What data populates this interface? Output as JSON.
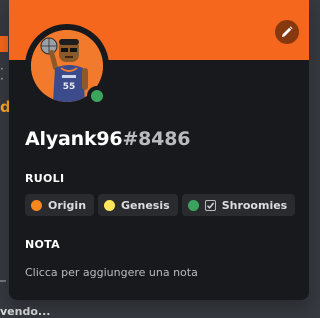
{
  "background": {
    "letter": "d",
    "typing_text": "vendo..."
  },
  "profile": {
    "banner_color": "#f5671c",
    "edit_icon": "pencil-icon",
    "status": "online",
    "status_color": "#3ba55d",
    "username": "Alyank96",
    "discriminator": "#8486",
    "jersey_number": "55"
  },
  "roles_section": {
    "title": "RUOLI",
    "roles": [
      {
        "name": "Origin",
        "color": "#f5871f",
        "checked": false
      },
      {
        "name": "Genesis",
        "color": "#fee75c",
        "checked": false
      },
      {
        "name": "Shroomies",
        "color": "#3ba55d",
        "checked": true
      }
    ]
  },
  "note_section": {
    "title": "NOTA",
    "placeholder": "Clicca per aggiungere una nota"
  }
}
